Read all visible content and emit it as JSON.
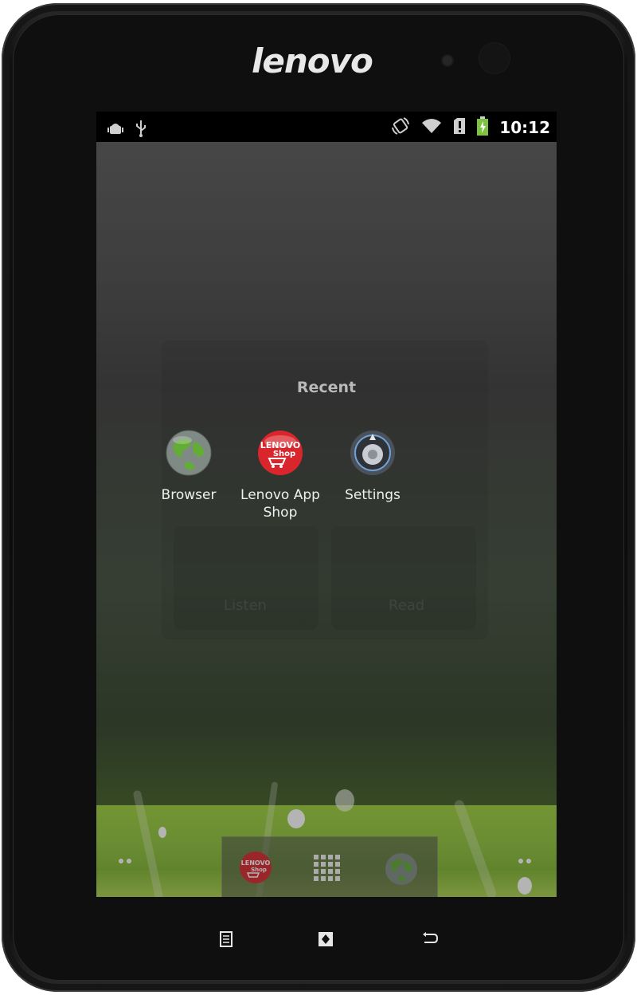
{
  "device": {
    "brand": "lenovo"
  },
  "status_bar": {
    "left_icons": [
      "android-debug-icon",
      "usb-icon"
    ],
    "right_icons": [
      "rotation-lock-icon",
      "wifi-icon",
      "sd-alert-icon",
      "battery-charging-icon"
    ],
    "time": "10:12"
  },
  "background_panels": {
    "labels": [
      "Listen",
      "Read"
    ]
  },
  "recent": {
    "title": "Recent",
    "apps": [
      {
        "label": "Browser",
        "icon": "globe-icon"
      },
      {
        "label": "Lenovo App Shop",
        "icon": "lenovo-shop-icon",
        "line1": "Lenovo App",
        "line2": "Shop"
      },
      {
        "label": "Settings",
        "icon": "settings-knob-icon"
      }
    ]
  },
  "dock": {
    "items": [
      "lenovo-shop-icon",
      "app-drawer-icon",
      "globe-icon"
    ]
  },
  "hardware_nav": [
    "menu-icon",
    "home-icon",
    "back-icon"
  ],
  "colors": {
    "status_bar": "#000000",
    "grass_green": "#9ccf3a",
    "shop_red": "#d8262c"
  }
}
